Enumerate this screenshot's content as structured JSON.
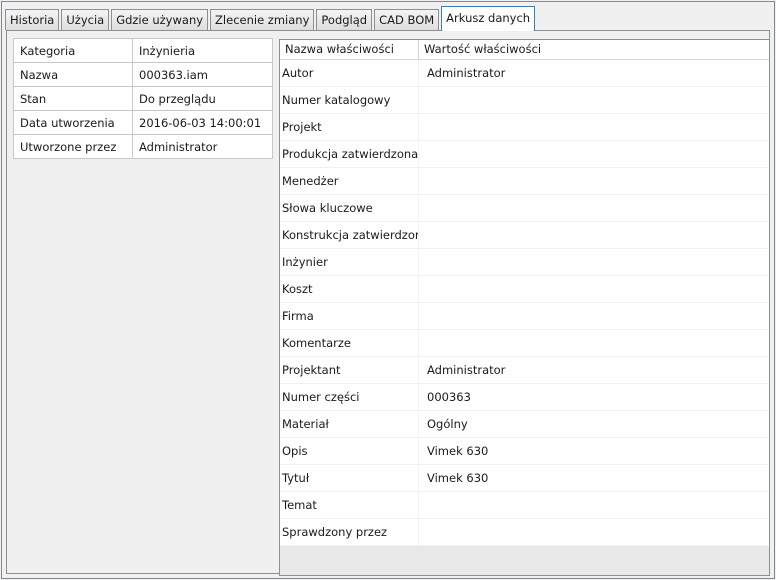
{
  "tabs": [
    "Historia",
    "Użycia",
    "Gdzie używany",
    "Zlecenie zmiany",
    "Podgląd",
    "CAD BOM",
    "Arkusz danych"
  ],
  "active_tab": "Arkusz danych",
  "summary": [
    {
      "key": "Kategoria",
      "value": "Inżynieria"
    },
    {
      "key": "Nazwa",
      "value": "000363.iam"
    },
    {
      "key": "Stan",
      "value": "Do przeglądu"
    },
    {
      "key": "Data utworzenia",
      "value": "2016-06-03 14:00:01"
    },
    {
      "key": "Utworzone przez",
      "value": "Administrator"
    }
  ],
  "properties": {
    "header": {
      "name": "Nazwa właściwości",
      "value": "Wartość właściwości"
    },
    "rows": [
      {
        "name": "Autor",
        "value": "Administrator"
      },
      {
        "name": "Numer katalogowy",
        "value": ""
      },
      {
        "name": "Projekt",
        "value": ""
      },
      {
        "name": "Produkcja zatwierdzona p",
        "value": ""
      },
      {
        "name": "Menedżer",
        "value": ""
      },
      {
        "name": "Słowa kluczowe",
        "value": ""
      },
      {
        "name": "Konstrukcja zatwierdzona",
        "value": ""
      },
      {
        "name": "Inżynier",
        "value": ""
      },
      {
        "name": "Koszt",
        "value": ""
      },
      {
        "name": "Firma",
        "value": ""
      },
      {
        "name": "Komentarze",
        "value": ""
      },
      {
        "name": "Projektant",
        "value": "Administrator"
      },
      {
        "name": "Numer części",
        "value": "000363"
      },
      {
        "name": "Materiał",
        "value": "Ogólny"
      },
      {
        "name": "Opis",
        "value": "Vimek 630"
      },
      {
        "name": "Tytuł",
        "value": "Vimek 630"
      },
      {
        "name": "Temat",
        "value": ""
      },
      {
        "name": "Sprawdzony przez",
        "value": ""
      }
    ]
  }
}
